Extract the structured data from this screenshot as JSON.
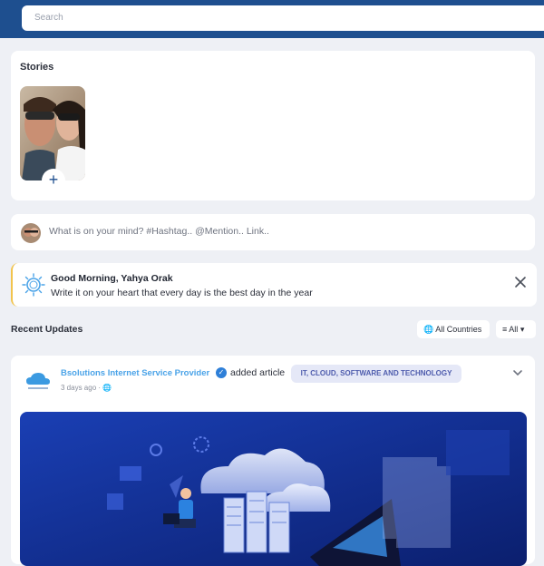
{
  "search": {
    "placeholder": "Search"
  },
  "stories": {
    "title": "Stories"
  },
  "composer": {
    "placeholder": "What is on your mind? #Hashtag.. @Mention.. Link.."
  },
  "greeting": {
    "title": "Good Morning, Yahya Orak",
    "message": "Write it on your heart that every day is the best day in the year"
  },
  "recent": {
    "title": "Recent Updates",
    "filter_countries": "All Countries",
    "filter_all": "All"
  },
  "post": {
    "author": "Bsolutions Internet Service Provider",
    "action": "added article",
    "tag": "IT, CLOUD, SOFTWARE AND TECHNOLOGY",
    "time": "3 days ago · 🌐"
  },
  "colors": {
    "header": "#1e4f8f",
    "accent": "#4aa3e8",
    "greeting_border": "#f2c44d"
  }
}
